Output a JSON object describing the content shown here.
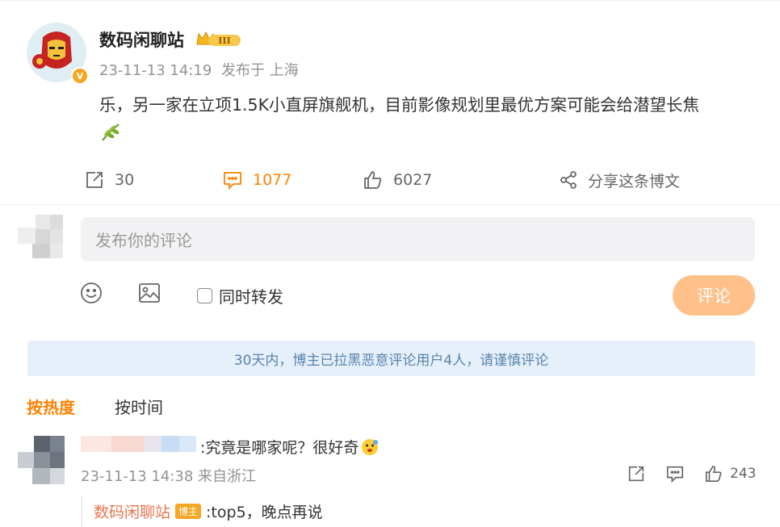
{
  "post": {
    "author": "数码闲聊站",
    "verified_mark": "V",
    "level_badge": "III",
    "timestamp": "23-11-13 14:19",
    "source": "发布于 上海",
    "content": "乐，另一家在立项1.5K小直屏旗舰机，目前影像规划里最优方案可能会给潜望长焦",
    "emoji": "leaf-emoji"
  },
  "actions": {
    "repost_count": "30",
    "comment_count": "1077",
    "like_count": "6027",
    "share_label": "分享这条博文"
  },
  "composer": {
    "placeholder": "发布你的评论",
    "repost_label": "同时转发",
    "submit_label": "评论"
  },
  "notice": "30天内，博主已拉黑恶意评论用户4人，请谨慎评论",
  "sort_tabs": [
    {
      "label": "按热度",
      "active": true
    },
    {
      "label": "按时间",
      "active": false
    }
  ],
  "comments": [
    {
      "text": ":究竟是哪家呢？很好奇",
      "timestamp": "23-11-13 14:38",
      "location": "来自浙江",
      "like_count": "243",
      "reply": {
        "author": "数码闲聊站",
        "badge": "博主",
        "text": ":top5，晚点再说"
      }
    }
  ],
  "colors": {
    "accent": "#ff8200",
    "submit_bg": "#ffc08a",
    "notice_bg": "#e5f0fa",
    "notice_text": "#5b84ad",
    "reply_author": "#eb7350"
  }
}
